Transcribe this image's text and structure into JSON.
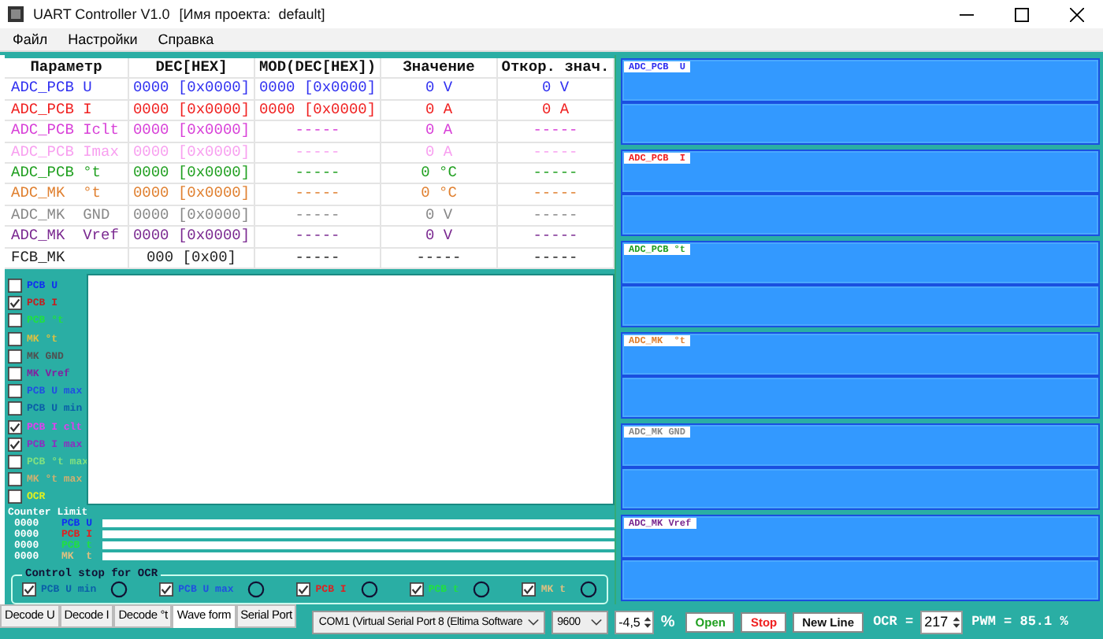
{
  "window": {
    "title": "UART Controller V1.0",
    "project": "[Имя проекта:  default]"
  },
  "menu": [
    "Файл",
    "Настройки",
    "Справка"
  ],
  "table": {
    "columns": [
      "Параметр",
      "DEC[HEX]",
      "MOD(DEC[HEX])",
      "Значение",
      "Откор. знач."
    ],
    "rows": [
      {
        "cells": [
          "ADC_PCB U",
          "0000 [0x0000]",
          "0000 [0x0000]",
          "0 V",
          "0 V"
        ],
        "color": "#3030f0"
      },
      {
        "cells": [
          "ADC_PCB I",
          "0000 [0x0000]",
          "0000 [0x0000]",
          "0 A",
          "0 A"
        ],
        "color": "#f02020"
      },
      {
        "cells": [
          "ADC_PCB Iclt",
          "0000 [0x0000]",
          "-----",
          "0 A",
          "-----"
        ],
        "color": "#d840d8"
      },
      {
        "cells": [
          "ADC_PCB Imax",
          "0000 [0x0000]",
          "-----",
          "0 A",
          "-----"
        ],
        "color": "#f8a0f0"
      },
      {
        "cells": [
          "ADC_PCB °t",
          "0000 [0x0000]",
          "-----",
          "0 °C",
          "-----"
        ],
        "color": "#20a020"
      },
      {
        "cells": [
          "ADC_MK  °t",
          "0000 [0x0000]",
          "-----",
          "0 °C",
          "-----"
        ],
        "color": "#e08030"
      },
      {
        "cells": [
          "ADC_MK  GND",
          "0000 [0x0000]",
          "-----",
          "0 V",
          "-----"
        ],
        "color": "#888888"
      },
      {
        "cells": [
          "ADC_MK  Vref",
          "0000 [0x0000]",
          "-----",
          "0 V",
          "-----"
        ],
        "color": "#7a2890"
      },
      {
        "cells": [
          "FCB_MK",
          "000 [0x00]",
          "-----",
          "-----",
          "-----"
        ],
        "color": "#202020"
      }
    ]
  },
  "channels": [
    {
      "label": "PCB U",
      "checked": false,
      "color": "#1030f0"
    },
    {
      "label": "PCB I",
      "checked": true,
      "color": "#c02020"
    },
    {
      "label": "PCB °t",
      "checked": false,
      "color": "#20e040"
    },
    {
      "label": "MK °t",
      "checked": false,
      "color": "#e0c040"
    },
    {
      "label": "MK GND",
      "checked": false,
      "color": "#505050"
    },
    {
      "label": "MK Vref",
      "checked": false,
      "color": "#8020a0"
    },
    {
      "label": "PCB U max",
      "checked": false,
      "color": "#2050e0"
    },
    {
      "label": "PCB U min",
      "checked": false,
      "color": "#0a5fa8"
    },
    {
      "label": "PCB I clt",
      "checked": true,
      "color": "#e040f0"
    },
    {
      "label": "PCB I max",
      "checked": true,
      "color": "#8a30c0"
    },
    {
      "label": "PCB °t max",
      "checked": false,
      "color": "#80e080"
    },
    {
      "label": "MK °t max",
      "checked": false,
      "color": "#d0b070"
    },
    {
      "label": "OCR",
      "checked": false,
      "color": "#e0f020"
    }
  ],
  "counter": {
    "title": "Counter Limit",
    "rows": [
      {
        "value": "0000",
        "label": "PCB U",
        "color": "#1030f0"
      },
      {
        "value": "0000",
        "label": "PCB I",
        "color": "#e02020"
      },
      {
        "value": "0000",
        "label": "PCB t",
        "color": "#20e040"
      },
      {
        "value": "0000",
        "label": "MK  t",
        "color": "#e0c080"
      }
    ]
  },
  "control_stop": {
    "title": "Control stop for OCR",
    "items": [
      {
        "label": "PCB U min",
        "checked": true,
        "color": "#0a5fa8"
      },
      {
        "label": "PCB U max",
        "checked": true,
        "color": "#2050e0"
      },
      {
        "label": "PCB I",
        "checked": true,
        "color": "#e02020"
      },
      {
        "label": "PCB t",
        "checked": true,
        "color": "#20e040"
      },
      {
        "label": "MK t",
        "checked": true,
        "color": "#e0c080"
      }
    ]
  },
  "panels": [
    {
      "label": "ADC_PCB  U",
      "color": "#3030f0"
    },
    {
      "label": "ADC_PCB  I",
      "color": "#f02020"
    },
    {
      "label": "ADC_PCB °t",
      "color": "#20a020"
    },
    {
      "label": "ADC_MK  °t",
      "color": "#e08030"
    },
    {
      "label": "ADC_MK GND",
      "color": "#888888"
    },
    {
      "label": "ADC_MK Vref",
      "color": "#7a2890"
    }
  ],
  "tabs": [
    {
      "label": "Decode U",
      "selected": false
    },
    {
      "label": "Decode I",
      "selected": false
    },
    {
      "label": "Decode °t",
      "selected": false
    },
    {
      "label": "Wave form",
      "selected": true
    },
    {
      "label": "Serial Port",
      "selected": false
    }
  ],
  "port": "COM1  (Virtual Serial Port 8 (Eltima Software",
  "baud": "9600",
  "offset": {
    "value": "-4,5",
    "unit": "%"
  },
  "buttons": [
    {
      "label": "Open",
      "color": "#20a020"
    },
    {
      "label": "Stop",
      "color": "#f02020"
    },
    {
      "label": "New Line",
      "color": "#101010"
    }
  ],
  "ocr": {
    "label": "OCR =",
    "value": "217",
    "pwm": "PWM = 85.1 %"
  }
}
